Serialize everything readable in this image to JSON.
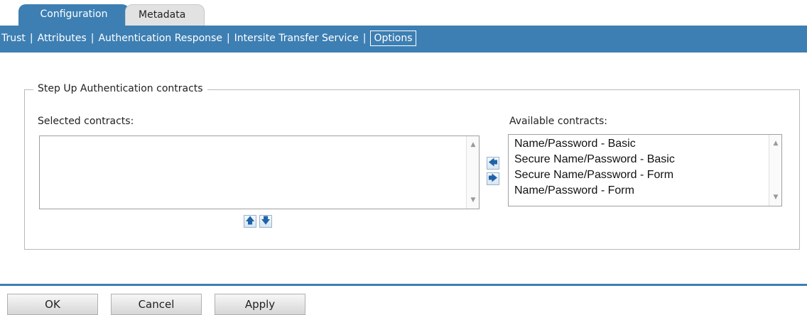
{
  "tabs": [
    {
      "label": "Configuration",
      "active": true
    },
    {
      "label": "Metadata",
      "active": false
    }
  ],
  "subnav": {
    "items": [
      {
        "label": "Trust"
      },
      {
        "label": "Attributes"
      },
      {
        "label": "Authentication Response"
      },
      {
        "label": "Intersite Transfer Service"
      },
      {
        "label": "Options",
        "active": true
      }
    ],
    "separator": "|"
  },
  "step_up": {
    "legend": "Step Up Authentication contracts",
    "selected_label": "Selected contracts:",
    "available_label": "Available contracts:",
    "selected_items": [],
    "available_items": [
      "Name/Password - Basic",
      "Secure Name/Password - Basic",
      "Secure Name/Password - Form",
      "Name/Password - Form"
    ]
  },
  "icons": {
    "move_left": "arrow-left-icon",
    "move_right": "arrow-right-icon",
    "move_up": "arrow-up-icon",
    "move_down": "arrow-down-icon"
  },
  "footer": {
    "ok_label": "OK",
    "cancel_label": "Cancel",
    "apply_label": "Apply"
  },
  "colors": {
    "accent": "#3d7fb3",
    "tab_inactive": "#e2e2e2"
  }
}
